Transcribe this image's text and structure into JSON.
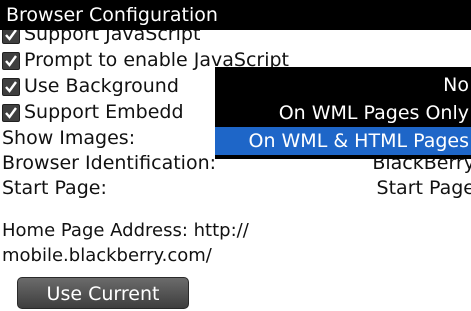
{
  "title": "Browser Configuration",
  "options": {
    "support_javascript": "Support JavaScript",
    "prompt_javascript": "Prompt to enable JavaScript",
    "use_background": "Use Background",
    "support_embedded": "Support Embedd"
  },
  "settings": {
    "show_images_label": "Show Images:",
    "browser_id_label": "Browser Identification:",
    "browser_id_value": "BlackBerry",
    "start_page_label": "Start Page:",
    "start_page_value": "Start Page"
  },
  "dropdown": {
    "items": [
      "No",
      "On WML Pages Only",
      "On WML & HTML Pages"
    ],
    "selected": "On WML & HTML Pages"
  },
  "home_page": {
    "line1": "Home Page Address: http://",
    "line2": "mobile.blackberry.com/"
  },
  "use_current_label": "Use Current",
  "colors": {
    "titlebar": "#000000",
    "selection": "#1e66c8",
    "checkbox": "#3f3f3f"
  }
}
